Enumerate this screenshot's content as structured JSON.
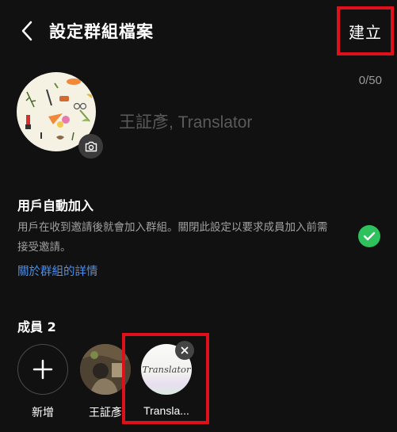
{
  "header": {
    "title": "設定群組檔案",
    "create_label": "建立"
  },
  "profile": {
    "char_count": "0/50",
    "group_name_placeholder": "王証彥, Translator"
  },
  "auto_join": {
    "title": "用戶自動加入",
    "description": "用戶在收到邀請後就會加入群組。關閉此設定以要求成員加入前需接受邀請。",
    "link": "關於群組的詳情",
    "enabled": true
  },
  "members": {
    "title": "成員 2",
    "items": [
      {
        "label": "新增",
        "type": "add"
      },
      {
        "label": "王証彥",
        "type": "member"
      },
      {
        "label": "Transla...",
        "type": "member",
        "avatar_text": "Translator"
      }
    ]
  },
  "colors": {
    "accent_green": "#2ec25c",
    "link_blue": "#4a8ff0",
    "highlight_red": "#e0101a"
  }
}
